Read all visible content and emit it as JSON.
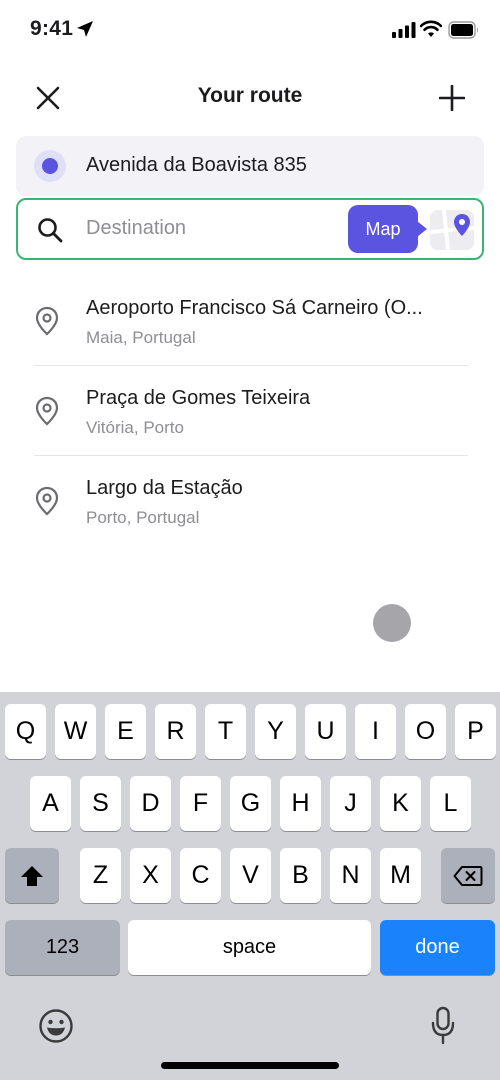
{
  "status_bar": {
    "time": "9:41"
  },
  "header": {
    "title": "Your route"
  },
  "origin": {
    "address": "Avenida da Boavista 835"
  },
  "destination": {
    "placeholder": "Destination",
    "value": "",
    "map_label": "Map"
  },
  "suggestions": [
    {
      "title": "Aeroporto Francisco Sá Carneiro (O...",
      "subtitle": "Maia, Portugal"
    },
    {
      "title": "Praça de Gomes Teixeira",
      "subtitle": "Vitória, Porto"
    },
    {
      "title": "Largo da Estação",
      "subtitle": "Porto, Portugal"
    }
  ],
  "keyboard": {
    "row1": [
      "Q",
      "W",
      "E",
      "R",
      "T",
      "Y",
      "U",
      "I",
      "O",
      "P"
    ],
    "row2": [
      "A",
      "S",
      "D",
      "F",
      "G",
      "H",
      "J",
      "K",
      "L"
    ],
    "row3": [
      "Z",
      "X",
      "C",
      "V",
      "B",
      "N",
      "M"
    ],
    "numbers_label": "123",
    "space_label": "space",
    "done_label": "done"
  },
  "colors": {
    "accent": "#5a54e0",
    "focus_border": "#3cb371",
    "done_key": "#1a82fb"
  },
  "icons": [
    "location-arrow-icon",
    "signal-icon",
    "wifi-icon",
    "battery-icon",
    "close-icon",
    "plus-icon",
    "search-icon",
    "map-pin-icon",
    "shift-icon",
    "backspace-icon",
    "emoji-icon",
    "microphone-icon"
  ]
}
